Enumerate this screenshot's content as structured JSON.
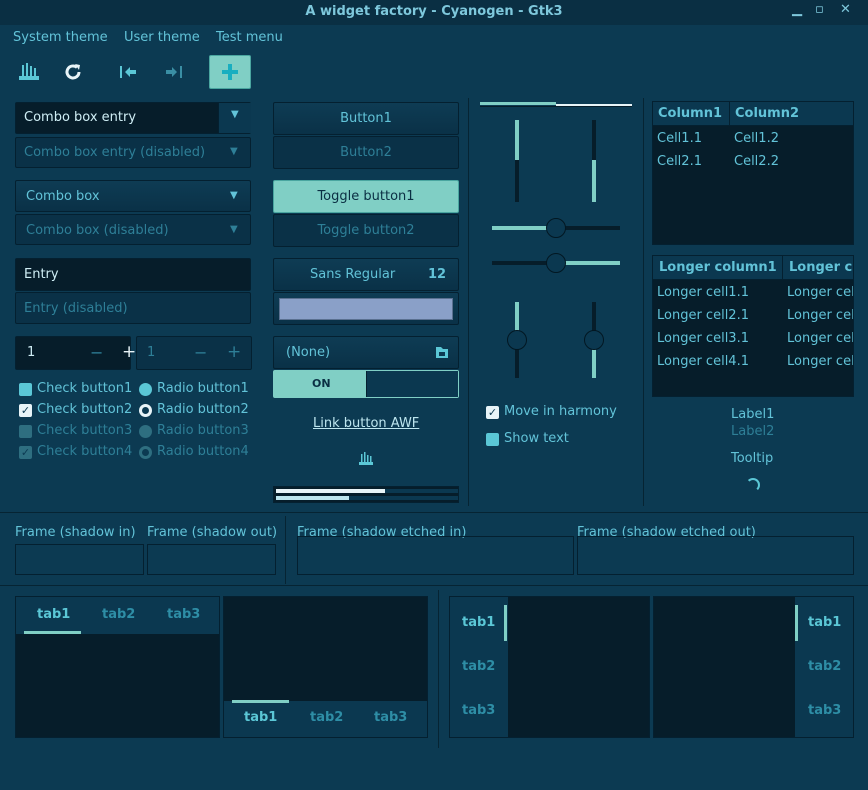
{
  "window": {
    "title": "A widget factory - Cyanogen - Gtk3",
    "minimize_icon": "minimize-icon",
    "maximize_icon": "maximize-icon",
    "close_icon": "close-icon"
  },
  "menubar": {
    "items": [
      "System theme",
      "User theme",
      "Test menu"
    ]
  },
  "toolbar": {
    "icons": [
      "organ-icon",
      "refresh-icon",
      "go-first-icon",
      "go-last-icon",
      "add-icon"
    ]
  },
  "combos": {
    "combo_entry": "Combo box entry",
    "combo_entry_disabled": "Combo box entry (disabled)",
    "combo_box": "Combo box",
    "combo_box_disabled": "Combo box (disabled)"
  },
  "entries": {
    "entry": "Entry",
    "entry_disabled": "Entry (disabled)"
  },
  "spins": {
    "spin1_value": "1",
    "spin2_value": "1",
    "minus": "−",
    "plus": "+"
  },
  "checks": [
    {
      "label": "Check button1",
      "checked": false,
      "disabled": false
    },
    {
      "label": "Check button2",
      "checked": true,
      "disabled": false
    },
    {
      "label": "Check button3",
      "checked": false,
      "disabled": true
    },
    {
      "label": "Check button4",
      "checked": true,
      "disabled": true
    }
  ],
  "radios": [
    {
      "label": "Radio button1",
      "selected": false,
      "disabled": false
    },
    {
      "label": "Radio button2",
      "selected": true,
      "disabled": false
    },
    {
      "label": "Radio button3",
      "selected": false,
      "disabled": true
    },
    {
      "label": "Radio button4",
      "selected": true,
      "disabled": true
    }
  ],
  "buttons": {
    "button1": "Button1",
    "button2": "Button2",
    "toggle1": "Toggle button1",
    "toggle2": "Toggle button2",
    "font_name": "Sans Regular",
    "font_size": "12",
    "file_chooser": "(None)",
    "switch_on": "ON",
    "link": "Link button AWF"
  },
  "colors": {
    "color_button": "#8aa0c8",
    "accent": "#5bc7d6",
    "toggle_active": "#80cfc5"
  },
  "progress": {
    "bar1": 0.6,
    "bar2": 0.4
  },
  "scales": {
    "move_harmony": "Move in harmony",
    "show_text": "Show text",
    "hscale1": 0.5,
    "hscale2": 0.5
  },
  "tree1": {
    "columns": [
      "Column1",
      "Column2"
    ],
    "rows": [
      [
        "Cell1.1",
        "Cell1.2"
      ],
      [
        "Cell2.1",
        "Cell2.2"
      ]
    ]
  },
  "tree2": {
    "columns": [
      "Longer column1",
      "Longer c"
    ],
    "rows": [
      [
        "Longer cell1.1",
        "Longer cel"
      ],
      [
        "Longer cell2.1",
        "Longer cel"
      ],
      [
        "Longer cell3.1",
        "Longer cel"
      ],
      [
        "Longer cell4.1",
        "Longer cel"
      ]
    ]
  },
  "labels": {
    "label1": "Label1",
    "label2": "Label2",
    "tooltip": "Tooltip"
  },
  "frames": {
    "shadow_in": "Frame (shadow in)",
    "shadow_out": "Frame (shadow out)",
    "etched_in": "Frame (shadow etched in)",
    "etched_out": "Frame (shadow etched out)"
  },
  "notebooks": {
    "tabs": [
      "tab1",
      "tab2",
      "tab3"
    ]
  }
}
